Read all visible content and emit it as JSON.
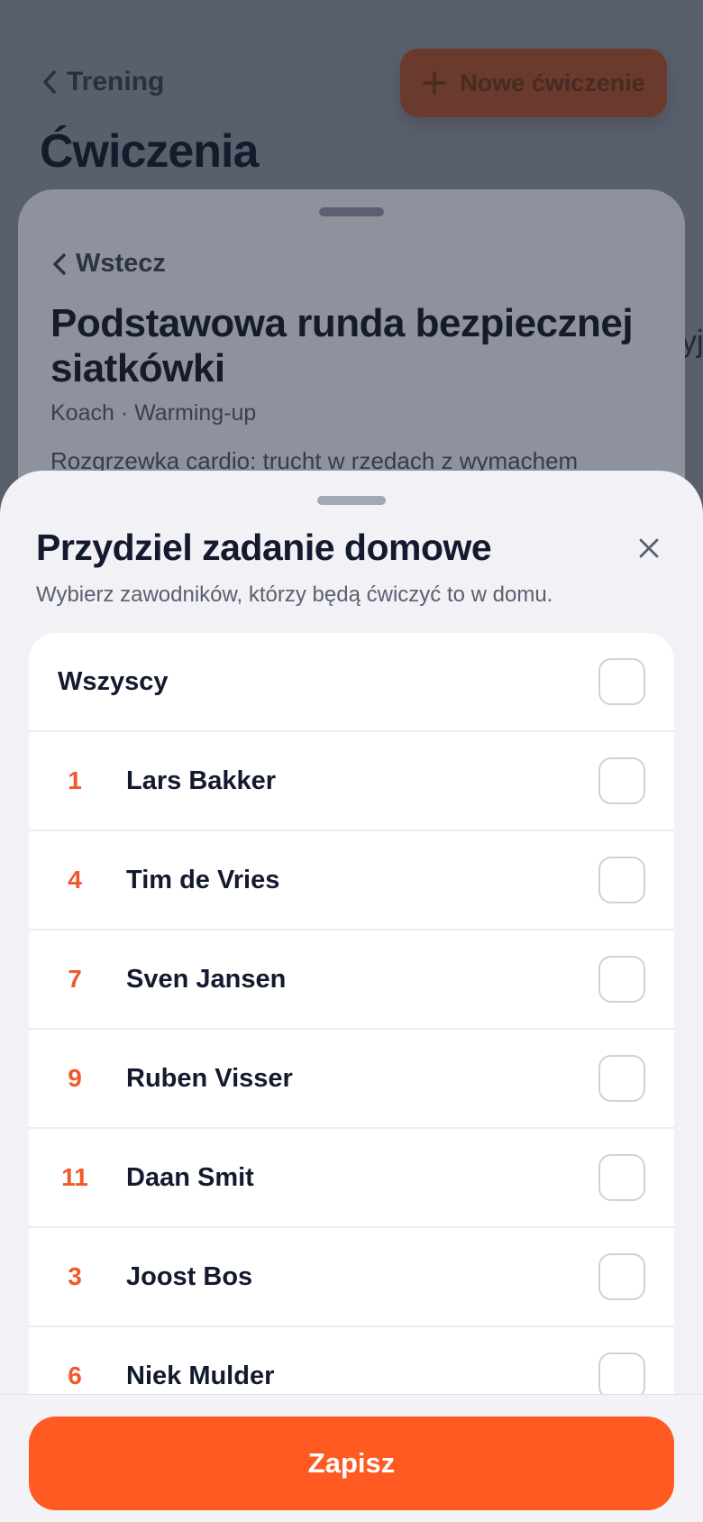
{
  "background": {
    "back_label": "Trening",
    "new_button_label": "Nowe ćwiczenie",
    "page_title": "Ćwiczenia",
    "cut_text": "yj"
  },
  "drill_sheet": {
    "back_label": "Wstecz",
    "title": "Podstawowa runda bezpiecznej siatkówki",
    "meta": "Koach · Warming-up",
    "description": "Rozgrzewka cardio: trucht w rzedach z wymachem"
  },
  "assign_sheet": {
    "title": "Przydziel zadanie domowe",
    "subtitle": "Wybierz zawodników, którzy będą ćwiczyć to w domu.",
    "all_label": "Wszyscy",
    "players": [
      {
        "number": "1",
        "name": "Lars Bakker"
      },
      {
        "number": "4",
        "name": "Tim de Vries"
      },
      {
        "number": "7",
        "name": "Sven Jansen"
      },
      {
        "number": "9",
        "name": "Ruben Visser"
      },
      {
        "number": "11",
        "name": "Daan Smit"
      },
      {
        "number": "3",
        "name": "Joost Bos"
      },
      {
        "number": "6",
        "name": "Niek Mulder"
      }
    ],
    "save_label": "Zapisz"
  },
  "colors": {
    "accent": "#ff5a21",
    "number": "#f2592a",
    "sheet_bg": "#f1f1f6",
    "text": "#141a2e"
  },
  "icons": {
    "back": "chevron-left-icon",
    "add": "plus-icon",
    "close": "close-icon"
  }
}
